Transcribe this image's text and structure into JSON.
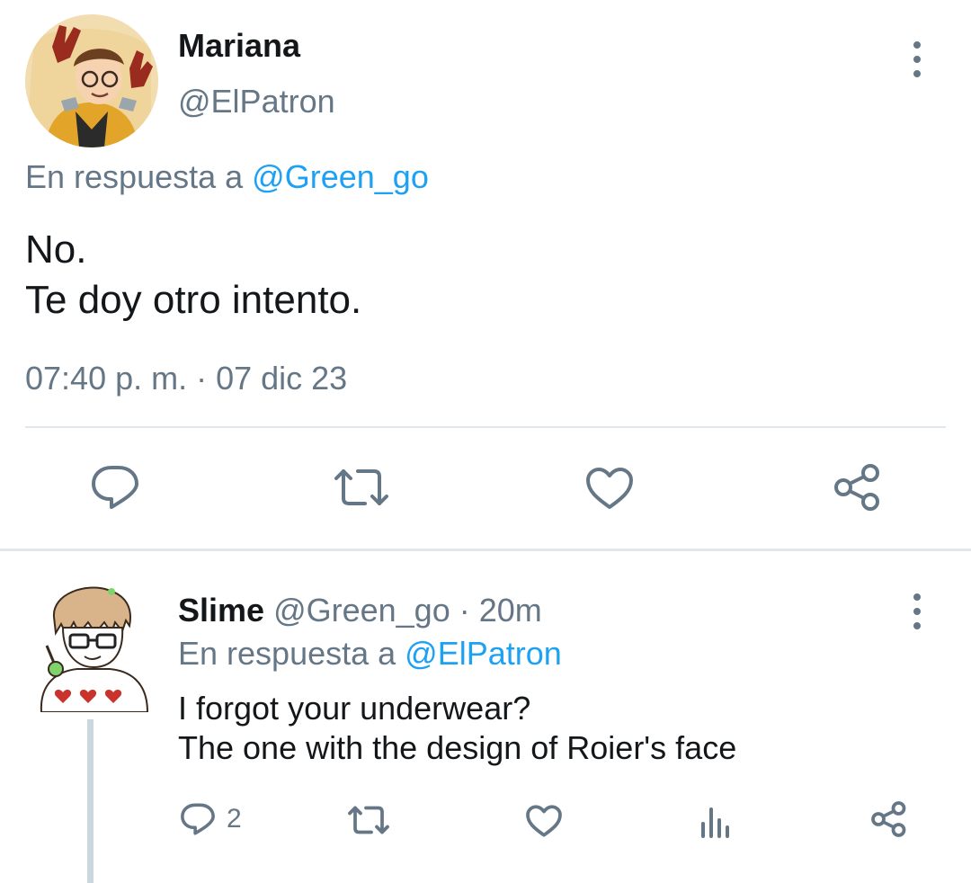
{
  "main_tweet": {
    "display_name": "Mariana",
    "handle": "@ElPatron",
    "reply_prefix": "En respuesta a",
    "reply_to": "@Green_go",
    "text_line1": "No.",
    "text_line2": "Te doy otro intento.",
    "timestamp": "07:40 p. m. · 07 dic 23",
    "actions": [
      "reply-icon",
      "retweet-icon",
      "like-icon",
      "share-icon"
    ]
  },
  "reply_tweet": {
    "display_name": "Slime",
    "handle": "@Green_go",
    "separator": "·",
    "time": "20m",
    "reply_prefix": "En respuesta a",
    "reply_to": "@ElPatron",
    "text_line1": "I forgot your underwear?",
    "text_line2": "The one with the design of Roier's face",
    "reply_count": "2",
    "actions": [
      "reply-icon",
      "retweet-icon",
      "like-icon",
      "stats-icon",
      "share-icon"
    ]
  },
  "colors": {
    "text": "#14171a",
    "muted": "#657786",
    "link": "#1da1f2",
    "divider": "#e1e8ed"
  }
}
